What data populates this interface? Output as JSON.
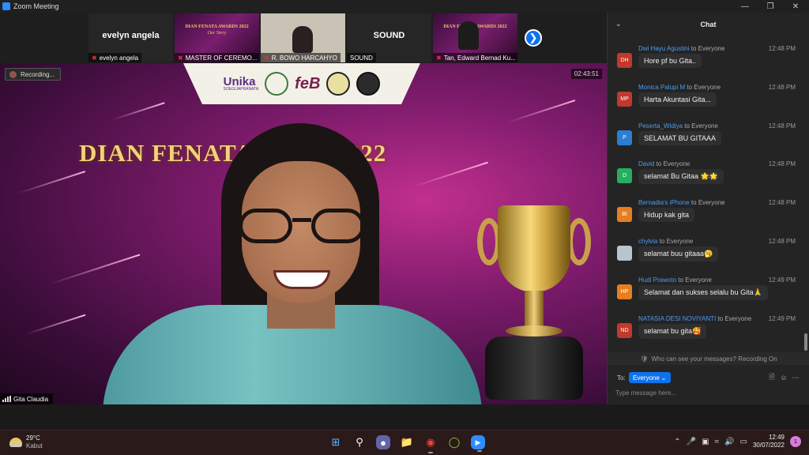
{
  "window": {
    "title": "Zoom Meeting"
  },
  "thumbnails": [
    {
      "name": "evelyn angela",
      "label": "evelyn angela",
      "type": "name"
    },
    {
      "label": "MASTER OF CEREMO...",
      "type": "poster",
      "poster_title": "DIAN FENATA AWARDS 2022",
      "poster_sub": "Our Story"
    },
    {
      "label": "R. BOWO HARCAHYO",
      "type": "room"
    },
    {
      "name": "SOUND",
      "label": "SOUND",
      "type": "name"
    },
    {
      "label": "Tan, Edward Bernad Ku...",
      "type": "poster",
      "poster_title": "DIAN FENATA AWARDS 2022",
      "poster_sub": ""
    }
  ],
  "main_video": {
    "recording_label": "Recording...",
    "timer": "02:43:51",
    "award_title": "DIAN FENATA      ARDS 2022",
    "logo_unika": "Unika",
    "logo_unika_sub": "SOEGIJAPRANATA",
    "logo_feb": "feB",
    "participant_name": "Gita Claudia"
  },
  "chat": {
    "title": "Chat",
    "messages": [
      {
        "initials": "DH",
        "avatar_color": "#c0392b",
        "sender": "Dwi Hayu Agustini",
        "to": "to Everyone",
        "time": "12:48 PM",
        "text": "Hore pf bu Gita.."
      },
      {
        "initials": "MP",
        "avatar_color": "#c0392b",
        "sender": "Monica Palupi M",
        "to": "to Everyone",
        "time": "12:48 PM",
        "text": "Harta Akuntasi Gita..."
      },
      {
        "initials": "P",
        "avatar_color": "#2d7dd2",
        "sender": "Peserta_Widiya",
        "to": "to Everyone",
        "time": "12:48 PM",
        "text": "SELAMAT BU GITAAA"
      },
      {
        "initials": "D",
        "avatar_color": "#27ae60",
        "sender": "David",
        "to": "to Everyone",
        "time": "12:48 PM",
        "text": "selamat Bu Gitaa 🌟🌟"
      },
      {
        "initials": "BI",
        "avatar_color": "#e67e22",
        "sender": "Bernadia's iPhone",
        "to": "to Everyone",
        "time": "12:48 PM",
        "text": "Hidup kak gita"
      },
      {
        "initials": "",
        "avatar_color": "#b9c4cc",
        "sender": "chylvia",
        "to": "to Everyone",
        "time": "12:48 PM",
        "text": "selamat buu gitaaa🥱"
      },
      {
        "initials": "HP",
        "avatar_color": "#e67e22",
        "sender": "Hudi Prawoto",
        "to": "to Everyone",
        "time": "12:49 PM",
        "text": "Selamat dan sukses selalu bu Gita🙏"
      },
      {
        "initials": "ND",
        "avatar_color": "#c0392b",
        "sender": "NATASIA DESI NOVIYANTI",
        "to": "to Everyone",
        "time": "12:49 PM",
        "text": "selamat bu gita🥰"
      }
    ],
    "visibility_notice": "Who can see your messages? Recording On",
    "to_label": "To:",
    "recipient": "Everyone",
    "input_placeholder": "Type message here..."
  },
  "taskbar": {
    "temperature": "29°C",
    "weather": "Kabut",
    "time": "12:49",
    "date": "30/07/2022",
    "notifications": "1"
  }
}
